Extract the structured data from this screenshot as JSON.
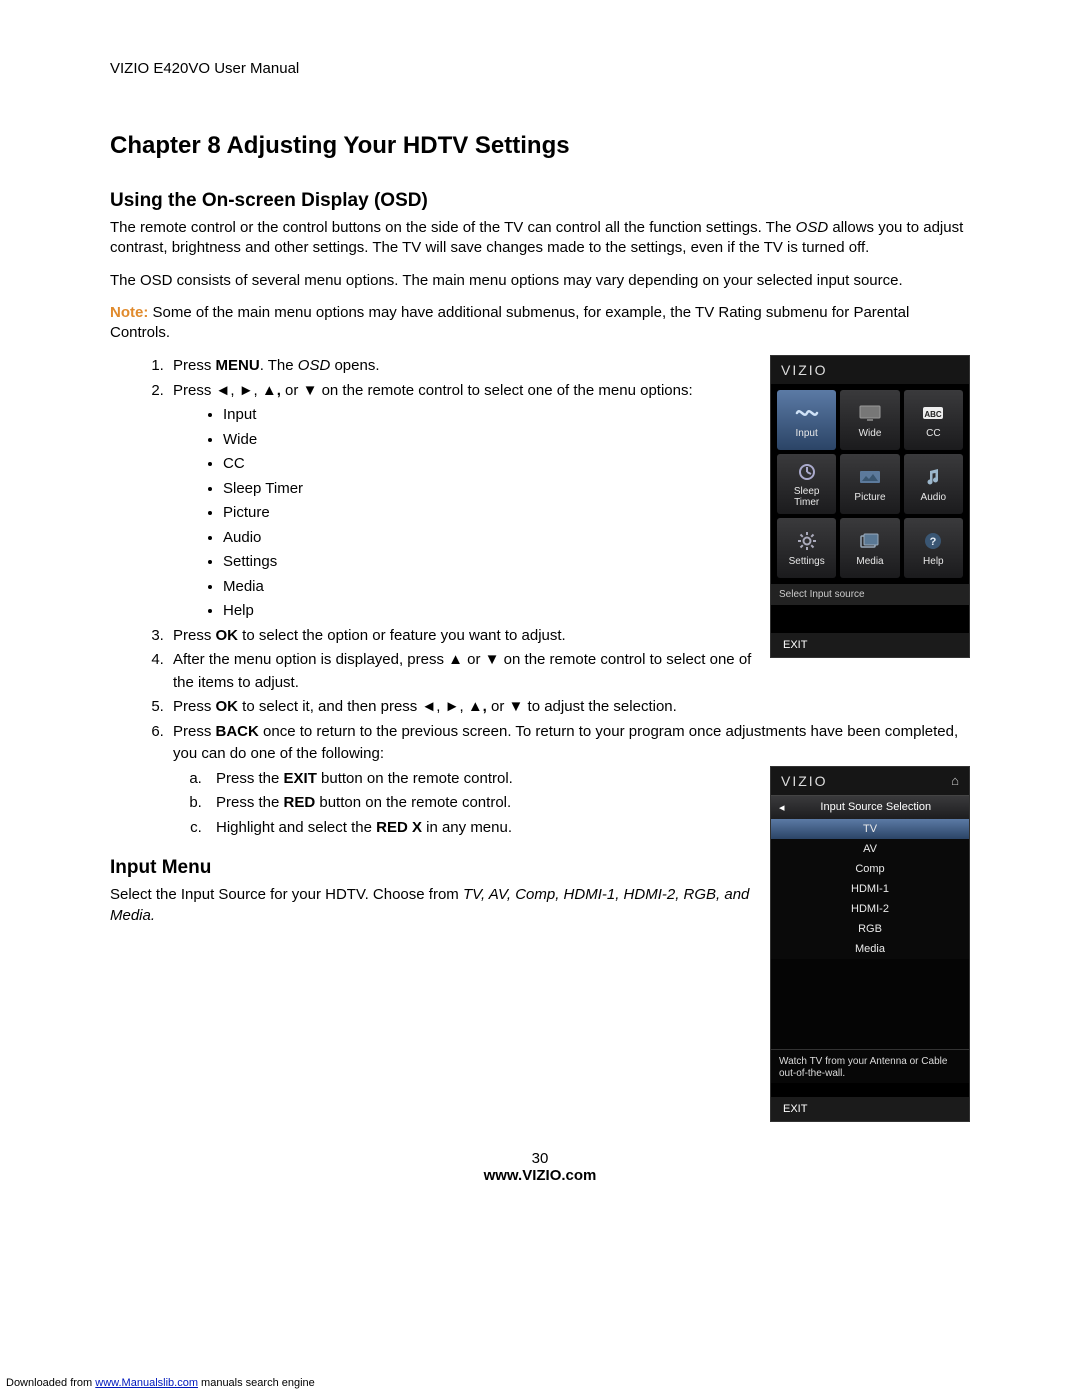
{
  "header": "VIZIO E420VO User Manual",
  "chapterTitle": "Chapter 8 Adjusting Your HDTV Settings",
  "sectionA": {
    "title": "Using the On-screen Display (OSD)",
    "p1a": "The remote control or the control buttons on the side of the TV can control all the function settings. The ",
    "p1b": "OSD",
    "p1c": " allows you to adjust contrast, brightness and other settings. The TV will save changes made to the settings, even if the TV is turned off.",
    "p2": "The OSD consists of several menu options. The main menu options may vary depending on your selected input source.",
    "noteLabel": "Note:",
    "noteText": "  Some of the main menu options may have additional submenus, for example, the TV Rating submenu for Parental Controls."
  },
  "steps": {
    "s1a": "Press ",
    "s1b": "MENU",
    "s1c": ". The ",
    "s1d": "OSD",
    "s1e": " opens.",
    "s2a": "Press ◄, ►, ▲",
    "s2b": ",",
    "s2c": " or ▼ on the remote control to select one of the menu options:",
    "menu": [
      "Input",
      "Wide",
      "CC",
      "Sleep Timer",
      "Picture",
      "Audio",
      "Settings",
      "Media",
      "Help"
    ],
    "s3a": "Press ",
    "s3b": "OK",
    "s3c": " to select the option or feature you want to adjust.",
    "s4": "After the menu option is displayed, press ▲ or ▼ on the remote control to select one of the items to adjust.",
    "s5a": "Press ",
    "s5b": "OK",
    "s5c": " to select it, and then press ◄, ►, ▲",
    "s5d": ",",
    "s5e": " or ▼ to adjust the selection.",
    "s6a": "Press ",
    "s6b": "BACK",
    "s6c": " once to return to the previous screen. To return to your program once adjustments have been completed, you can do one of the following:",
    "sub": {
      "a1": "Press the ",
      "a2": "EXIT",
      "a3": " button on the remote control.",
      "b1": "Press the ",
      "b2": "RED",
      "b3": " button on the remote control.",
      "c1": "Highlight and select the ",
      "c2": "RED X",
      "c3": " in any menu."
    }
  },
  "sectionB": {
    "title": "Input Menu",
    "p1a": "Select the Input Source for your HDTV. Choose from ",
    "p1b": "TV, AV, Comp, HDMI-1, HDMI-2, RGB, and Media."
  },
  "osd": {
    "logo": "VIZIO",
    "tiles": [
      {
        "label": "Input",
        "selected": true
      },
      {
        "label": "Wide"
      },
      {
        "label": "CC"
      },
      {
        "label": "Sleep\nTimer"
      },
      {
        "label": "Picture"
      },
      {
        "label": "Audio"
      },
      {
        "label": "Settings"
      },
      {
        "label": "Media"
      },
      {
        "label": "Help"
      }
    ],
    "status": "Select Input source",
    "exit": "EXIT"
  },
  "inputPanel": {
    "logo": "VIZIO",
    "back": "◂",
    "title": "Input Source Selection",
    "items": [
      "TV",
      "AV",
      "Comp",
      "HDMI-1",
      "HDMI-2",
      "RGB",
      "Media"
    ],
    "selectedIndex": 0,
    "desc": "Watch TV from your Antenna or Cable out-of-the-wall.",
    "exit": "EXIT"
  },
  "pageNumber": "30",
  "siteUrl": "www.VIZIO.com",
  "dlFooter": {
    "prefix": "Downloaded from ",
    "link": "www.Manualslib.com",
    "suffix": " manuals search engine"
  }
}
